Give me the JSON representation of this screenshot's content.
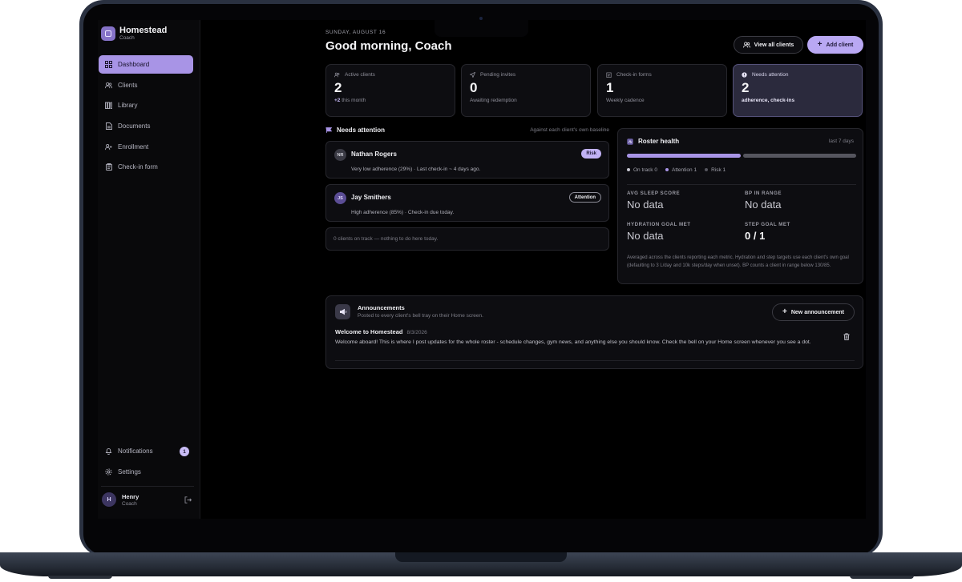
{
  "app": {
    "name": "Homestead",
    "role": "Coach"
  },
  "sidebar": {
    "items": [
      {
        "label": "Dashboard",
        "icon": "grid-icon",
        "active": true
      },
      {
        "label": "Clients",
        "icon": "users-icon"
      },
      {
        "label": "Library",
        "icon": "library-icon"
      },
      {
        "label": "Documents",
        "icon": "document-icon"
      },
      {
        "label": "Enrollment",
        "icon": "user-plus-icon"
      },
      {
        "label": "Check-in form",
        "icon": "clipboard-icon"
      }
    ],
    "bottom": [
      {
        "label": "Notifications",
        "icon": "bell-icon",
        "badge": "1"
      },
      {
        "label": "Settings",
        "icon": "gear-icon"
      }
    ],
    "user": {
      "initial": "H",
      "name": "Henry",
      "role": "Coach"
    }
  },
  "header": {
    "date": "SUNDAY, AUGUST 16",
    "greeting": "Good morning, Coach",
    "view_all_label": "View all clients",
    "add_client_label": "Add client"
  },
  "stats": [
    {
      "label": "Active clients",
      "value": "2",
      "sub_strong": "+2",
      "sub": " this month"
    },
    {
      "label": "Pending invites",
      "value": "0",
      "sub": "Awaiting redemption"
    },
    {
      "label": "Check-in forms",
      "value": "1",
      "sub": "Weekly cadence"
    },
    {
      "label": "Needs attention",
      "value": "2",
      "sub": "adherence, check-ins"
    }
  ],
  "attention": {
    "title": "Needs attention",
    "note": "Against each client's own baseline",
    "clients": [
      {
        "initials": "NR",
        "name": "Nathan Rogers",
        "desc": "Very low adherence (29%) · Last check-in ~ 4 days ago.",
        "tag": "Risk"
      },
      {
        "initials": "JS",
        "name": "Jay Smithers",
        "desc": "High adherence (85%) · Check-in due today.",
        "tag": "Attention"
      }
    ],
    "on_track": "0 clients on track — nothing to do here today."
  },
  "roster": {
    "title": "Roster health",
    "period": "last 7 days",
    "legend": [
      {
        "label": "On track 0",
        "color": "#c8c8d2",
        "count": 0
      },
      {
        "label": "Attention 1",
        "color": "#a894e6",
        "count": 1
      },
      {
        "label": "Risk 1",
        "color": "#55555e",
        "count": 1
      }
    ],
    "metrics": [
      {
        "label": "AVG SLEEP SCORE",
        "value": "No data"
      },
      {
        "label": "BP IN RANGE",
        "value": "No data"
      },
      {
        "label": "HYDRATION GOAL MET",
        "value": "No data"
      },
      {
        "label": "STEP GOAL MET",
        "value": "0 / 1"
      }
    ],
    "footnote": "Averaged across the clients reporting each metric. Hydration and step targets use each client's own goal (defaulting to 3 L/day and 10k steps/day when unset). BP counts a client in range below 130/85."
  },
  "announcements": {
    "title": "Announcements",
    "subtitle": "Posted to every client's bell tray on their Home screen.",
    "new_label": "New announcement",
    "post": {
      "title": "Welcome to Homestead",
      "date": "8/3/2026",
      "body": "Welcome aboard! This is where I post updates for the whole roster - schedule changes, gym news, and anything else you should know. Check the bell on your Home screen whenever you see a dot."
    }
  }
}
